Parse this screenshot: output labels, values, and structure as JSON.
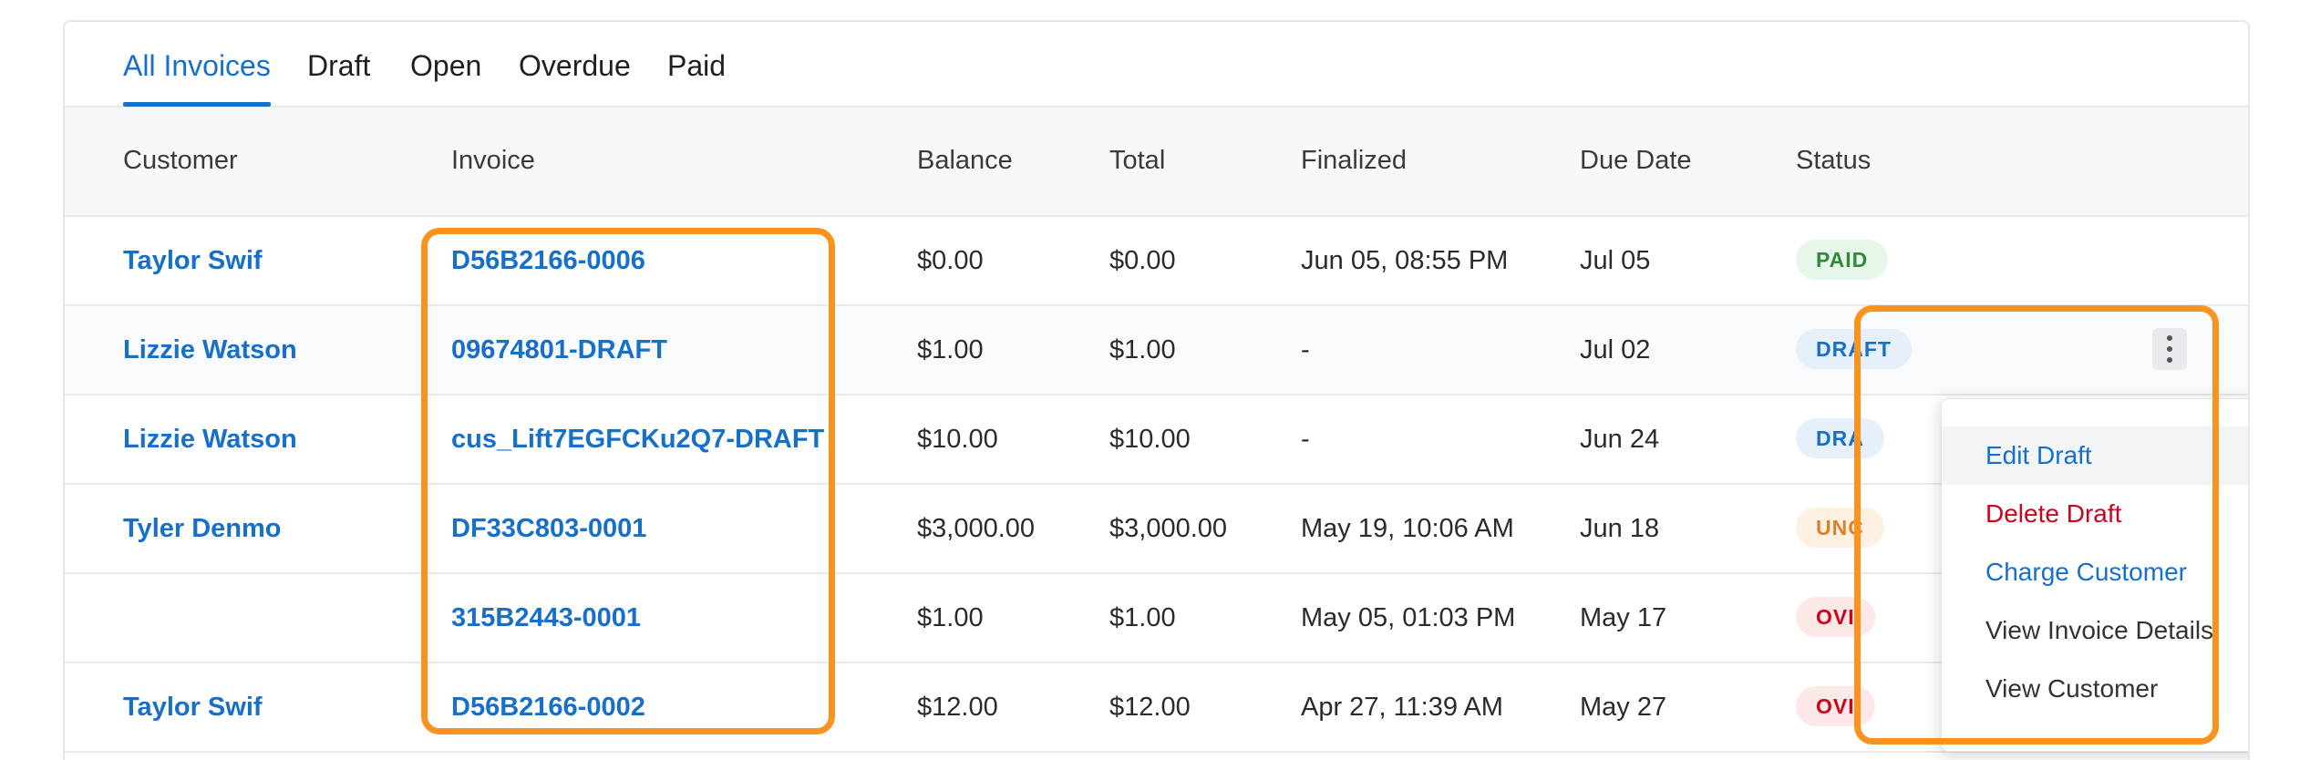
{
  "tabs": [
    {
      "label": "All Invoices",
      "active": true
    },
    {
      "label": "Draft"
    },
    {
      "label": "Open"
    },
    {
      "label": "Overdue"
    },
    {
      "label": "Paid"
    }
  ],
  "columns": {
    "customer": "Customer",
    "invoice": "Invoice",
    "balance": "Balance",
    "total": "Total",
    "finalized": "Finalized",
    "due_date": "Due Date",
    "status": "Status"
  },
  "rows": [
    {
      "customer": "Taylor Swif",
      "invoice": "D56B2166-0006",
      "balance": "$0.00",
      "total": "$0.00",
      "finalized": "Jun 05, 08:55 PM",
      "due_date": "Jul 05",
      "status": "PAID"
    },
    {
      "customer": "Lizzie Watson",
      "invoice": "09674801-DRAFT",
      "balance": "$1.00",
      "total": "$1.00",
      "finalized": "-",
      "due_date": "Jul 02",
      "status": "DRAFT"
    },
    {
      "customer": "Lizzie Watson",
      "invoice": "cus_Lift7EGFCKu2Q7-DRAFT",
      "balance": "$10.00",
      "total": "$10.00",
      "finalized": "-",
      "due_date": "Jun 24",
      "status": "DRA"
    },
    {
      "customer": "Tyler Denmo",
      "invoice": "DF33C803-0001",
      "balance": "$3,000.00",
      "total": "$3,000.00",
      "finalized": "May 19, 10:06 AM",
      "due_date": "Jun 18",
      "status": "UNC"
    },
    {
      "customer": "",
      "invoice": "315B2443-0001",
      "balance": "$1.00",
      "total": "$1.00",
      "finalized": "May 05, 01:03 PM",
      "due_date": "May 17",
      "status": "OVI"
    },
    {
      "customer": "Taylor Swif",
      "invoice": "D56B2166-0002",
      "balance": "$12.00",
      "total": "$12.00",
      "finalized": "Apr 27, 11:39 AM",
      "due_date": "May 27",
      "status": "OVI"
    }
  ],
  "status_colors": {
    "paid": {
      "bg": "#e6f6e8",
      "fg": "#2e8b3a"
    },
    "draft": {
      "bg": "#e6f0fb",
      "fg": "#1670c9"
    },
    "uncollectible": {
      "bg": "#fdf1e1",
      "fg": "#d9822b"
    },
    "overdue": {
      "bg": "#fde8e8",
      "fg": "#d0021b"
    }
  },
  "menu": {
    "items": [
      {
        "label": "Edit Draft",
        "color": "#1670c9"
      },
      {
        "label": "Delete Draft",
        "color": "#d0021b"
      },
      {
        "label": "Charge Customer",
        "color": "#1670c9"
      },
      {
        "label": "View Invoice Details",
        "color": "#333333"
      },
      {
        "label": "View Customer",
        "color": "#333333"
      }
    ]
  },
  "icons": {
    "row_actions": "kebab-menu-icon"
  },
  "accent_color": "#1670c9",
  "highlight_color": "#f7931e"
}
